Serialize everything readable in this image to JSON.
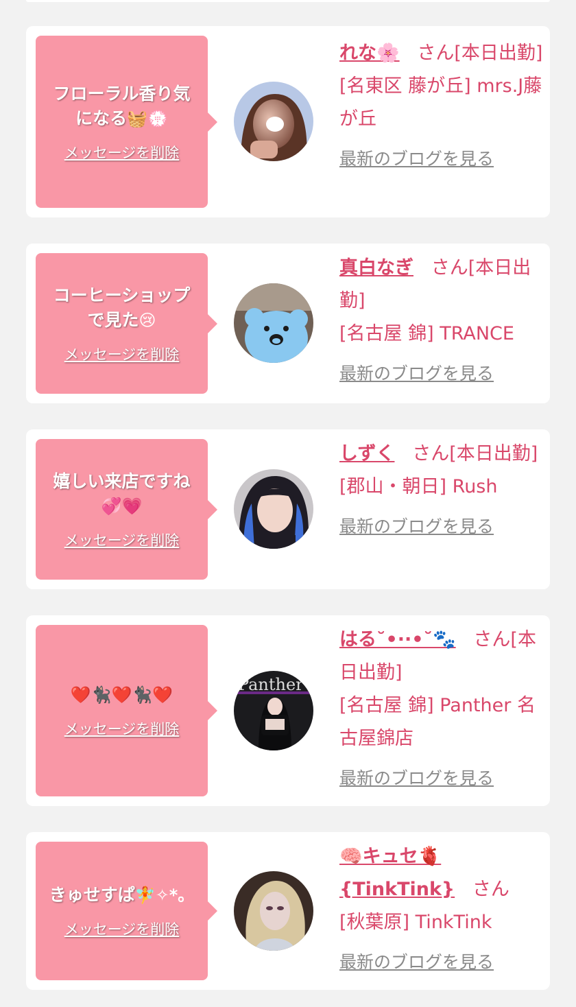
{
  "delete_label": "メッセージを削除",
  "blog_label": "最新のブログを見る",
  "cards": [
    {
      "message_text": "フローラル香り気\nになる",
      "message_emoji": "🧺💮",
      "name": "れな🌸",
      "suffix": "さん[本日出勤]",
      "shop": "[名東区 藤が丘] mrs.J藤が丘"
    },
    {
      "message_text": "コーヒーショップ\nで見た",
      "message_emoji": "😢",
      "name": "真白なぎ",
      "suffix": "さん[本日出勤]",
      "shop": "[名古屋 錦] TRANCE"
    },
    {
      "message_text": "嬉しい来店ですね\n",
      "message_emoji": "💞💗",
      "name": "しずく",
      "suffix": "さん[本日出勤]",
      "shop": "[郡山・朝日] Rush"
    },
    {
      "message_text": "",
      "message_emoji": "❤️🐈‍⬛❤️🐈‍⬛❤️",
      "name": "はる˘•··•˘🐾",
      "suffix": "さん[本日出勤]",
      "shop": "[名古屋 錦] Panther 名古屋錦店"
    },
    {
      "message_text": "きゅせすぱ",
      "message_emoji": "🧚✧*。",
      "name": "🧠キュセ🫀{TinkTink}",
      "suffix": "さん",
      "shop": "[秋葉原] TinkTink"
    }
  ]
}
